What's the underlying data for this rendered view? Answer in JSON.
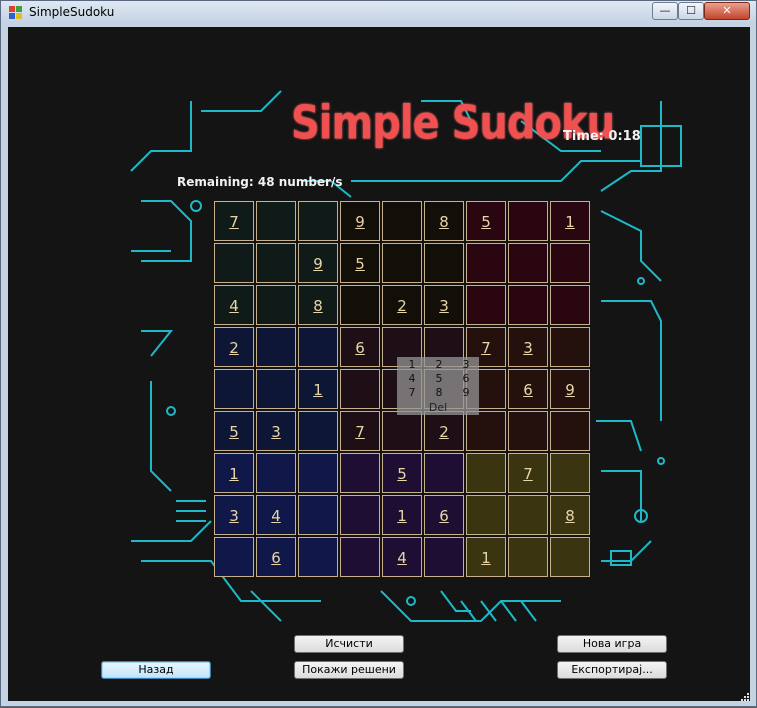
{
  "window": {
    "title": "SimpleSudoku",
    "controls": {
      "minimize": "—",
      "maximize": "☐",
      "close": "✕"
    }
  },
  "game": {
    "title": "Simple Sudoku",
    "time": "Time: 0:18",
    "remaining": "Remaining: 48 number/s",
    "grid": [
      [
        "7",
        "",
        "",
        "9",
        "",
        "8",
        "5",
        "",
        "1"
      ],
      [
        "",
        "",
        "9",
        "5",
        "",
        "",
        "",
        "",
        ""
      ],
      [
        "4",
        "",
        "8",
        "",
        "2",
        "3",
        "",
        "",
        ""
      ],
      [
        "2",
        "",
        "",
        "6",
        "",
        "",
        "7",
        "3",
        ""
      ],
      [
        "",
        "",
        "1",
        "",
        "",
        "",
        "",
        "6",
        "9"
      ],
      [
        "5",
        "3",
        "",
        "7",
        "",
        "2",
        "",
        "",
        ""
      ],
      [
        "1",
        "",
        "",
        "",
        "5",
        "",
        "",
        "7",
        ""
      ],
      [
        "3",
        "4",
        "",
        "",
        "1",
        "6",
        "",
        "",
        "8"
      ],
      [
        "",
        "6",
        "",
        "",
        "4",
        "",
        "1",
        "",
        ""
      ]
    ],
    "box_colors": [
      [
        "#101a18",
        "#120e08",
        "#2a0610"
      ],
      [
        "#0e1636",
        "#1e0e16",
        "#24100c"
      ],
      [
        "#10184a",
        "#1e0e34",
        "#3a3410"
      ]
    ],
    "keypad": {
      "digits": [
        "1",
        "2",
        "3",
        "4",
        "5",
        "6",
        "7",
        "8",
        "9"
      ],
      "delete_label": "Del"
    }
  },
  "buttons": {
    "clear": "Исчисти",
    "show_solved": "Покажи решени",
    "new_game": "Нова игра",
    "export": "Експортирај...",
    "back": "Назад"
  }
}
